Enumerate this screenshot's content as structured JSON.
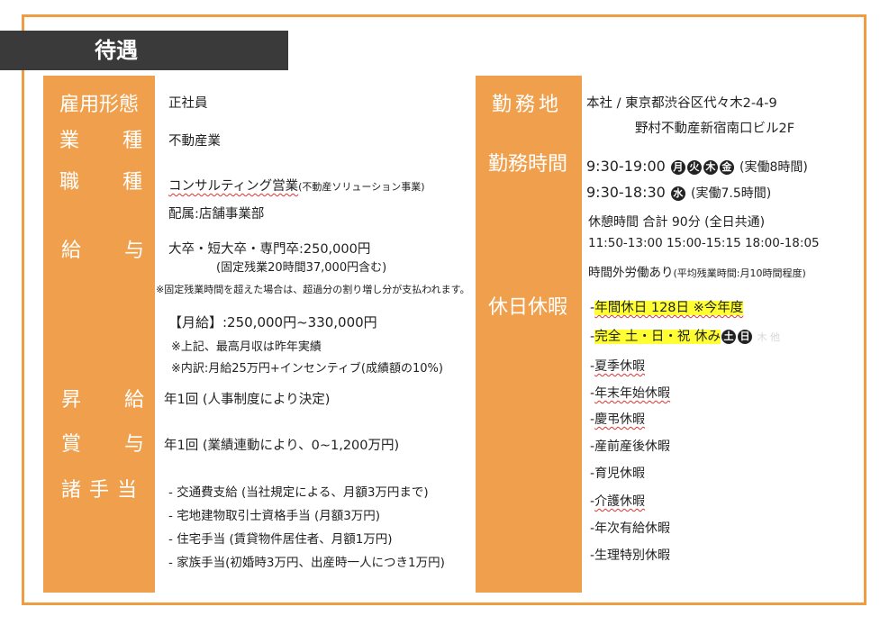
{
  "header": {
    "title": "待遇"
  },
  "left": {
    "koyo": {
      "label": "雇用形態",
      "value": "正社員"
    },
    "gyoshu": {
      "label_a": "業",
      "label_b": "種",
      "value": "不動産業"
    },
    "shokushu": {
      "label_a": "職",
      "label_b": "種",
      "value_main": "コンサルティング営業",
      "value_sub": "(不動産ソリューション事業)",
      "value_dept": "配属:店舗事業部"
    },
    "kyuyo": {
      "label_a": "給",
      "label_b": "与",
      "line1": "大卒・短大卒・専門卒:250,000円",
      "line2": "(固定残業20時間37,000円含む)",
      "note": "※固定残業時間を超えた場合は、超過分の割り増し分が支払われます。",
      "monthly": "【月給】:250,000円~330,000円",
      "max_note": "※上記、最高月収は昨年実績",
      "breakdown": "※内訳:月給25万円+インセンティブ(成績額の10%)"
    },
    "shokyu": {
      "label_a": "昇",
      "label_b": "給",
      "value": "年1回 (人事制度により決定)"
    },
    "shoyo": {
      "label_a": "賞",
      "label_b": "与",
      "value": "年1回 (業績連動により、0~1,200万円)"
    },
    "teate": {
      "label": "諸手当",
      "items": [
        "- 交通費支給 (当社規定による、月額3万円まで)",
        "- 宅地建物取引士資格手当 (月額3万円)",
        "- 住宅手当 (賃貸物件居住者、月額1万円)",
        "- 家族手当(初婚時3万円、出産時一人につき1万円)"
      ]
    }
  },
  "right": {
    "kinmuchi": {
      "label": "勤務地",
      "line1": "本社 / 東京都渋谷区代々木2-4-9",
      "line2": "野村不動産新宿南口ビル2F"
    },
    "kinmujikan": {
      "label": "勤務時間",
      "line1_time": "9:30-19:00",
      "line1_days": [
        "月",
        "火",
        "木",
        "金"
      ],
      "line1_note": "(実働8時間)",
      "line2_time": "9:30-18:30",
      "line2_days": [
        "水"
      ],
      "line2_note": "(実働7.5時間)",
      "break_title": "休憩時間 合計 90分 (全日共通)",
      "break_times": "11:50-13:00 15:00-15:15 18:00-18:05",
      "overtime": "時間外労働あり",
      "overtime_note": "(平均残業時間:月10時間程度)"
    },
    "kyujitsu": {
      "label": "休日休暇",
      "annual": "年間休日 128日 ※今年度",
      "full": "完全 土・日・祝 休み",
      "full_days": [
        "土",
        "日"
      ],
      "ghost": "木 他",
      "items": [
        "夏季休暇",
        "年末年始休暇",
        "慶弔休暇",
        "産前産後休暇",
        "育児休暇",
        "介護休暇",
        "年次有給休暇",
        "生理特別休暇"
      ]
    }
  },
  "colors": {
    "accent": "#f0a04c",
    "header_bg": "#3a3a3a",
    "highlight": "#ffff33"
  }
}
